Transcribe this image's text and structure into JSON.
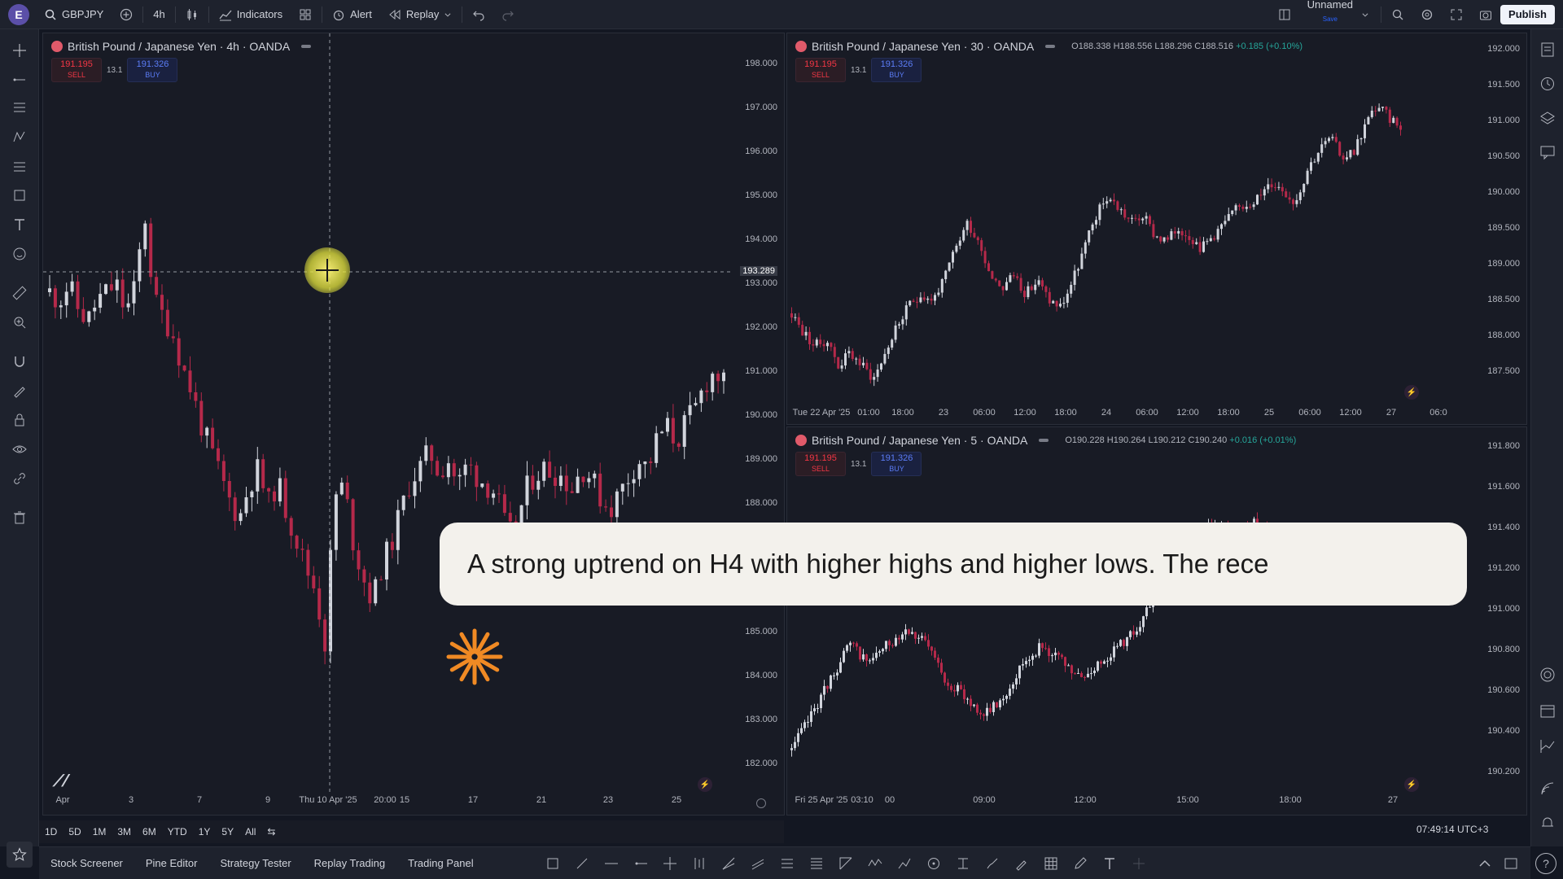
{
  "topbar": {
    "avatar_letter": "E",
    "symbol": "GBPJPY",
    "interval": "4h",
    "indicators_label": "Indicators",
    "alert_label": "Alert",
    "replay_label": "Replay",
    "layout_name": "Unnamed",
    "layout_sub": "Save",
    "publish_label": "Publish"
  },
  "panes": {
    "h4": {
      "title": "British Pound / Japanese Yen · 4h · OANDA",
      "sell_price": "191.195",
      "sell_label": "SELL",
      "buy_price": "191.326",
      "buy_label": "BUY",
      "spread": "13.1",
      "price_labels": [
        "198.000",
        "197.000",
        "196.000",
        "195.000",
        "194.000",
        "193.000",
        "192.000",
        "191.000",
        "190.000",
        "189.000",
        "188.000",
        "185.000",
        "184.000",
        "183.000",
        "182.000"
      ],
      "crosshair_price": "193.289",
      "time_labels": [
        "Apr",
        "3",
        "7",
        "9",
        "Thu 10 Apr '25",
        "20:00",
        "15",
        "17",
        "21",
        "23",
        "25"
      ]
    },
    "m30": {
      "title": "British Pound / Japanese Yen · 30 · OANDA",
      "ohlc_o": "O188.338",
      "ohlc_h": "H188.556",
      "ohlc_l": "L188.296",
      "ohlc_c": "C188.516",
      "ohlc_change": "+0.185 (+0.10%)",
      "sell_price": "191.195",
      "sell_label": "SELL",
      "buy_price": "191.326",
      "buy_label": "BUY",
      "spread": "13.1",
      "price_labels": [
        "192.000",
        "191.500",
        "191.000",
        "190.500",
        "190.000",
        "189.500",
        "189.000",
        "188.500",
        "188.000",
        "187.500"
      ],
      "time_labels": [
        "Tue 22 Apr '25",
        "01:00",
        "18:00",
        "23",
        "06:00",
        "12:00",
        "18:00",
        "24",
        "06:00",
        "12:00",
        "18:00",
        "25",
        "06:00",
        "12:00",
        "27",
        "06:0"
      ]
    },
    "m5": {
      "title": "British Pound / Japanese Yen · 5 · OANDA",
      "ohlc_o": "O190.228",
      "ohlc_h": "H190.264",
      "ohlc_l": "L190.212",
      "ohlc_c": "C190.240",
      "ohlc_change": "+0.016 (+0.01%)",
      "sell_price": "191.195",
      "sell_label": "SELL",
      "buy_price": "191.326",
      "buy_label": "BUY",
      "spread": "13.1",
      "price_labels": [
        "191.800",
        "191.600",
        "191.400",
        "191.200",
        "191.000",
        "190.800",
        "190.600",
        "190.400",
        "190.200"
      ],
      "time_labels": [
        "Fri 25 Apr '25",
        "03:10",
        "00",
        "09:00",
        "12:00",
        "15:00",
        "18:00",
        "27"
      ]
    }
  },
  "range_buttons": [
    "1D",
    "5D",
    "1M",
    "3M",
    "6M",
    "YTD",
    "1Y",
    "5Y",
    "All"
  ],
  "clock": "07:49:14 UTC+3",
  "bottom_tabs": [
    "Stock Screener",
    "Pine Editor",
    "Strategy Tester",
    "Replay Trading",
    "Trading Panel"
  ],
  "caption": "A strong uptrend on H4 with higher highs and higher lows. The rece",
  "colors": {
    "up": "#d1d4dc",
    "down": "#b5294a",
    "accent": "#2962ff"
  },
  "chart_data": [
    {
      "type": "candlestick",
      "title": "British Pound / Japanese Yen · 4h · OANDA",
      "ylim": [
        181.5,
        199
      ],
      "x_ticks": [
        "Apr",
        "3",
        "7",
        "9",
        "Thu 10 Apr '25",
        "20:00",
        "15",
        "17",
        "21",
        "23",
        "25"
      ],
      "close_path": [
        193.4,
        193.2,
        193.6,
        193.0,
        192.7,
        193.2,
        193.4,
        193.6,
        192.9,
        193.5,
        195.3,
        193.2,
        192.8,
        192.4,
        191.6,
        191.0,
        190.2,
        189.6,
        189.0,
        188.4,
        188.0,
        188.8,
        189.2,
        188.3,
        188.9,
        188.1,
        187.5,
        186.8,
        186.3,
        185.0,
        188.5,
        188.8,
        187.4,
        186.6,
        186.0,
        186.9,
        187.4,
        188.2,
        188.9,
        189.2,
        189.6,
        189.1,
        189.4,
        188.8,
        189.3,
        189.0,
        188.8,
        188.6,
        187.8,
        187.5,
        188.6,
        189.0,
        189.2,
        189.1,
        189.0,
        188.7,
        189.2,
        189.0,
        188.5,
        188.2,
        188.6,
        189.0,
        189.4,
        189.2,
        189.9,
        190.2,
        189.8,
        190.3,
        190.6,
        191.2,
        191.5,
        191.2
      ],
      "crosshair_price": 193.289
    },
    {
      "type": "candlestick",
      "title": "British Pound / Japanese Yen · 30 · OANDA",
      "ylim": [
        187.2,
        192.2
      ],
      "x_ticks": [
        "Tue 22 Apr '25",
        "01:00",
        "18:00",
        "23",
        "06:00",
        "12:00",
        "18:00",
        "24",
        "06:00",
        "12:00",
        "18:00",
        "25",
        "06:00",
        "12:00",
        "27",
        "06:0"
      ],
      "close_path": [
        188.4,
        188.1,
        187.9,
        188.0,
        187.6,
        187.8,
        187.6,
        187.4,
        187.8,
        188.2,
        188.5,
        188.7,
        188.6,
        188.9,
        189.4,
        189.8,
        189.5,
        189.0,
        188.8,
        189.0,
        188.7,
        188.9,
        188.6,
        188.5,
        188.9,
        189.4,
        189.9,
        190.2,
        190.0,
        189.8,
        189.9,
        189.6,
        189.5,
        189.7,
        189.6,
        189.4,
        189.6,
        189.8,
        190.0,
        190.1,
        190.2,
        190.4,
        190.3,
        190.1,
        190.6,
        190.9,
        191.1,
        190.8,
        190.9,
        191.3,
        191.6,
        191.4,
        191.3
      ]
    },
    {
      "type": "candlestick",
      "title": "British Pound / Japanese Yen · 5 · OANDA",
      "ylim": [
        190.1,
        191.95
      ],
      "x_ticks": [
        "Fri 25 Apr '25",
        "03:10",
        "00",
        "09:00",
        "12:00",
        "15:00",
        "18:00",
        "27"
      ],
      "close_path": [
        190.3,
        190.5,
        190.7,
        190.9,
        190.8,
        190.9,
        191.0,
        190.9,
        190.7,
        190.6,
        190.5,
        190.6,
        190.8,
        190.9,
        190.8,
        190.7,
        190.8,
        190.9,
        191.0,
        191.2,
        191.3,
        191.5,
        191.6,
        191.5,
        191.6,
        191.5
      ]
    }
  ]
}
